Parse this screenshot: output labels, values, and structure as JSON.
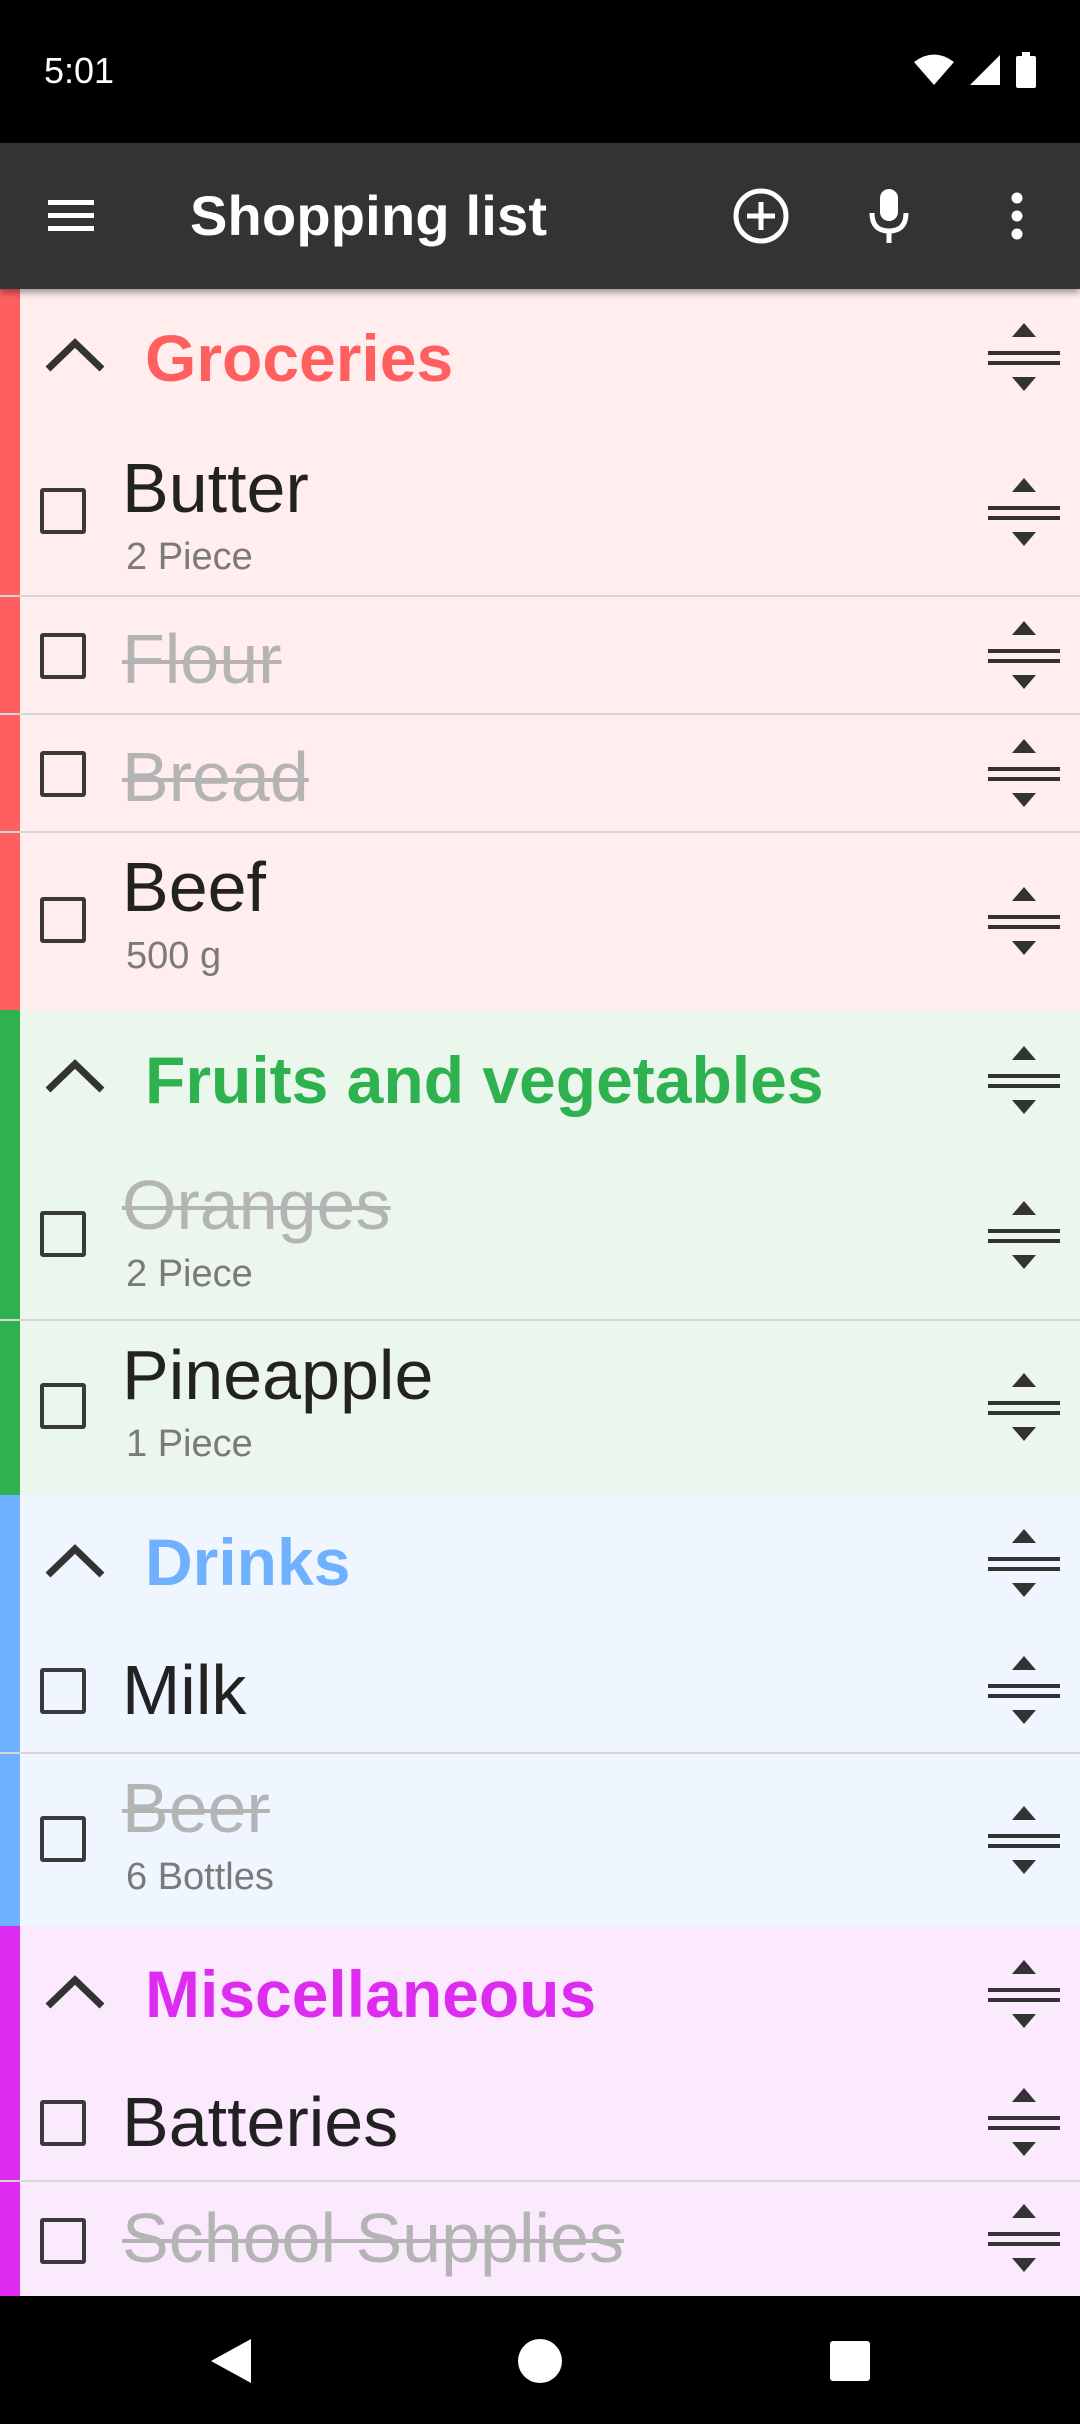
{
  "status_bar": {
    "time": "5:01"
  },
  "app_bar": {
    "title": "Shopping list"
  },
  "colors": {
    "groceries": "#ff5f5f",
    "fruits": "#2eb24f",
    "drinks": "#6fb0ff",
    "misc": "#dd2cf0"
  },
  "sections": [
    {
      "title": "Groceries",
      "items": [
        {
          "name": "Butter",
          "qty": "2 Piece",
          "done": false
        },
        {
          "name": "Flour",
          "qty": "",
          "done": true
        },
        {
          "name": "Bread",
          "qty": "",
          "done": true
        },
        {
          "name": "Beef",
          "qty": "500 g",
          "done": false
        }
      ]
    },
    {
      "title": "Fruits and vegetables",
      "items": [
        {
          "name": "Oranges",
          "qty": "2 Piece",
          "done": true
        },
        {
          "name": "Pineapple",
          "qty": "1 Piece",
          "done": false
        }
      ]
    },
    {
      "title": "Drinks",
      "items": [
        {
          "name": "Milk",
          "qty": "",
          "done": false
        },
        {
          "name": "Beer",
          "qty": "6 Bottles",
          "done": true
        }
      ]
    },
    {
      "title": "Miscellaneous",
      "items": [
        {
          "name": "Batteries",
          "qty": "",
          "done": false
        },
        {
          "name": "School Supplies",
          "qty": "",
          "done": true
        }
      ]
    }
  ],
  "icons": {
    "menu": "hamburger-menu-icon",
    "add": "add-circle-icon",
    "voice": "microphone-icon",
    "more": "more-vert-icon",
    "collapse": "chevron-up-icon",
    "reorder": "drag-reorder-icon"
  }
}
